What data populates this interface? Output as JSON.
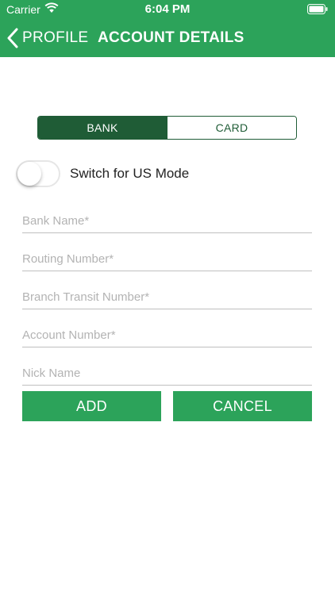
{
  "status_bar": {
    "carrier": "Carrier",
    "time": "6:04 PM",
    "wifi_icon": "wifi-icon",
    "battery_icon": "battery-icon"
  },
  "nav": {
    "back_label": "PROFILE",
    "title": "ACCOUNT DETAILS",
    "back_icon": "chevron-left-icon"
  },
  "segments": [
    {
      "label": "BANK",
      "selected": true
    },
    {
      "label": "CARD",
      "selected": false
    }
  ],
  "us_mode": {
    "label": "Switch for US Mode",
    "on": false
  },
  "fields": [
    {
      "placeholder": "Bank Name*",
      "value": ""
    },
    {
      "placeholder": "Routing Number*",
      "value": ""
    },
    {
      "placeholder": "Branch Transit Number*",
      "value": ""
    },
    {
      "placeholder": "Account Number*",
      "value": ""
    },
    {
      "placeholder": "Nick Name",
      "value": ""
    }
  ],
  "buttons": {
    "add": "ADD",
    "cancel": "CANCEL"
  },
  "colors": {
    "header": "#2ca35a",
    "segment_active": "#1f5c36",
    "button": "#2ca35a"
  }
}
